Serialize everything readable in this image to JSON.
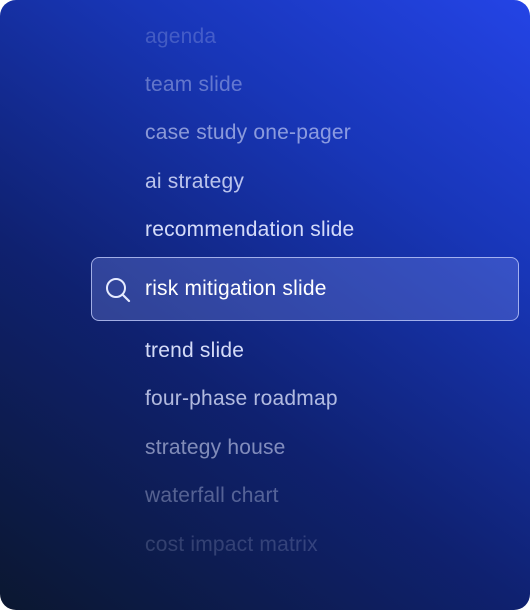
{
  "list": {
    "items_above": [
      {
        "label": "agenda"
      },
      {
        "label": "team slide"
      },
      {
        "label": "case study one-pager"
      },
      {
        "label": "ai strategy"
      },
      {
        "label": "recommendation slide"
      }
    ],
    "selected": {
      "label": "risk mitigation slide",
      "icon": "search-icon"
    },
    "items_below": [
      {
        "label": "trend slide"
      },
      {
        "label": "four-phase roadmap"
      },
      {
        "label": "strategy house"
      },
      {
        "label": "waterfall chart"
      },
      {
        "label": "cost impact matrix"
      }
    ]
  }
}
